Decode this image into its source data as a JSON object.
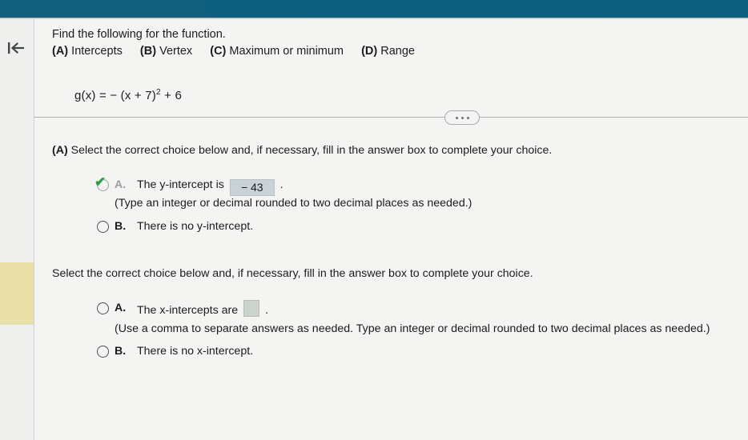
{
  "window": {
    "topbar_color": "#0d5f80",
    "highlight_color": "#e8e0a6"
  },
  "rail": {
    "back_icon": "skip-to-start-arrow-icon"
  },
  "problem": {
    "instruction": "Find the following for the function.",
    "parts": [
      {
        "tag": "(A)",
        "label": "Intercepts"
      },
      {
        "tag": "(B)",
        "label": "Vertex"
      },
      {
        "tag": "(C)",
        "label": "Maximum or minimum"
      },
      {
        "tag": "(D)",
        "label": "Range"
      }
    ],
    "function_prefix": "g(x) = − (x + 7)",
    "function_exponent": "2",
    "function_suffix": "+ 6"
  },
  "divider": {
    "menu_icon": "ellipsis-horizontal-icon"
  },
  "sections": [
    {
      "tag": "(A)",
      "heading": "Select the correct choice below and, if necessary, fill in the answer box to complete your choice.",
      "choices": [
        {
          "letter": "A.",
          "text_before": "The y-intercept is",
          "answer_value": "− 43",
          "text_after": ".",
          "state": "answered-correct",
          "check_glyph": "✔"
        },
        {
          "letter": "B.",
          "text_before": "There is no y-intercept.",
          "answer_value": "",
          "text_after": "",
          "state": "unselected",
          "check_glyph": ""
        }
      ],
      "note": "(Type an integer or decimal rounded to two decimal places as needed.)"
    },
    {
      "tag": "",
      "heading": "Select the correct choice below and, if necessary, fill in the answer box to complete your choice.",
      "choices": [
        {
          "letter": "A.",
          "text_before": "The x-intercepts are",
          "answer_value": "",
          "text_after": ".",
          "state": "unselected-empty-box",
          "check_glyph": ""
        },
        {
          "letter": "B.",
          "text_before": "There is no x-intercept.",
          "answer_value": "",
          "text_after": "",
          "state": "unselected",
          "check_glyph": ""
        }
      ],
      "note": "(Use a comma to separate answers as needed. Type an integer or decimal rounded to two decimal places as needed.)"
    }
  ]
}
